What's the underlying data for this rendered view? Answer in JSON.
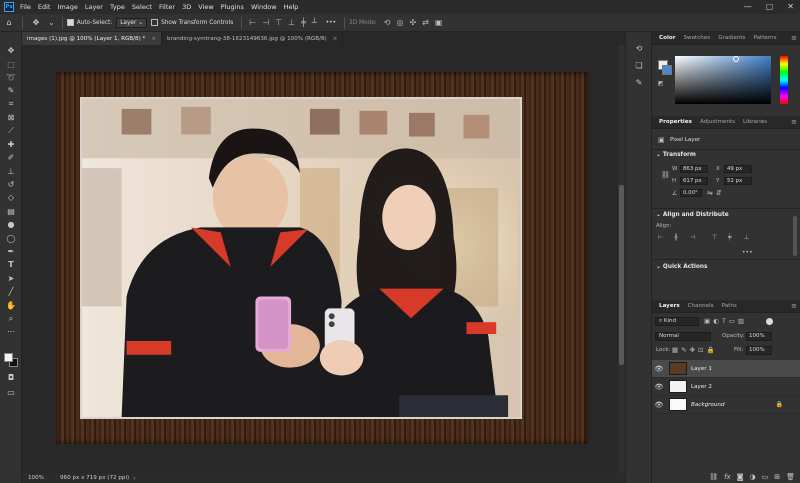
{
  "app": {
    "logo": "Ps"
  },
  "menu": [
    "File",
    "Edit",
    "Image",
    "Layer",
    "Type",
    "Select",
    "Filter",
    "3D",
    "View",
    "Plugins",
    "Window",
    "Help"
  ],
  "window_controls": {
    "minimize": "—",
    "maximize": "▢",
    "close": "✕"
  },
  "options_bar": {
    "home_icon": "home-icon",
    "move_icon": "move-tool-icon",
    "auto_select_label": "Auto-Select:",
    "auto_select_checked": true,
    "auto_select_target": "Layer",
    "show_transform_label": "Show Transform Controls",
    "show_transform_checked": false,
    "mode_3d_label": "3D Mode:",
    "more": "•••"
  },
  "tabs": [
    {
      "label": "images (1).jpg @ 100% (Layer 1, RGB/8) *",
      "close": "×",
      "active": true
    },
    {
      "label": "branding-symtrang-38-1623149636.jpg @ 100% (RGB/8)",
      "close": "×",
      "active": false
    }
  ],
  "tools": [
    "move",
    "marquee",
    "lasso",
    "quick-select",
    "crop",
    "frame",
    "eyedropper",
    "healing",
    "brush",
    "stamp",
    "history-brush",
    "eraser",
    "gradient",
    "blur",
    "dodge",
    "pen",
    "type",
    "path-select",
    "rectangle",
    "hand",
    "zoom",
    "more"
  ],
  "status": {
    "zoom": "100%",
    "doc_size": "960 px x 719 px (72 ppi)",
    "arrow": "›"
  },
  "color_panel": {
    "tabs": [
      "Color",
      "Swatches",
      "Gradients",
      "Patterns"
    ],
    "active_tab": "Color",
    "accent": "#3f7fc8"
  },
  "properties_panel": {
    "tabs": [
      "Properties",
      "Adjustments",
      "Libraries"
    ],
    "active_tab": "Properties",
    "layer_type": "Pixel Layer",
    "transform_header": "Transform",
    "w_label": "W",
    "w_value": "863 px",
    "h_label": "H",
    "h_value": "617 px",
    "x_label": "X",
    "x_value": "49 px",
    "y_label": "Y",
    "y_value": "51 px",
    "angle_value": "0.00°",
    "align_header": "Align and Distribute",
    "align_label": "Align:",
    "quick_actions_header": "Quick Actions",
    "more": "•••"
  },
  "layers_panel": {
    "tabs": [
      "Layers",
      "Channels",
      "Paths"
    ],
    "active_tab": "Layers",
    "filter_kind": "Kind",
    "blend_mode": "Normal",
    "opacity_label": "Opacity:",
    "opacity_value": "100%",
    "lock_label": "Lock:",
    "fill_label": "Fill:",
    "fill_value": "100%",
    "layers": [
      {
        "name": "Layer 1",
        "visible": true,
        "selected": true
      },
      {
        "name": "Layer 2",
        "visible": true,
        "selected": false
      },
      {
        "name": "Background",
        "visible": true,
        "selected": false,
        "locked": true
      }
    ],
    "footer_icons": [
      "link-icon",
      "fx-icon",
      "mask-icon",
      "adjustment-icon",
      "group-icon",
      "new-layer-icon",
      "trash-icon"
    ]
  }
}
